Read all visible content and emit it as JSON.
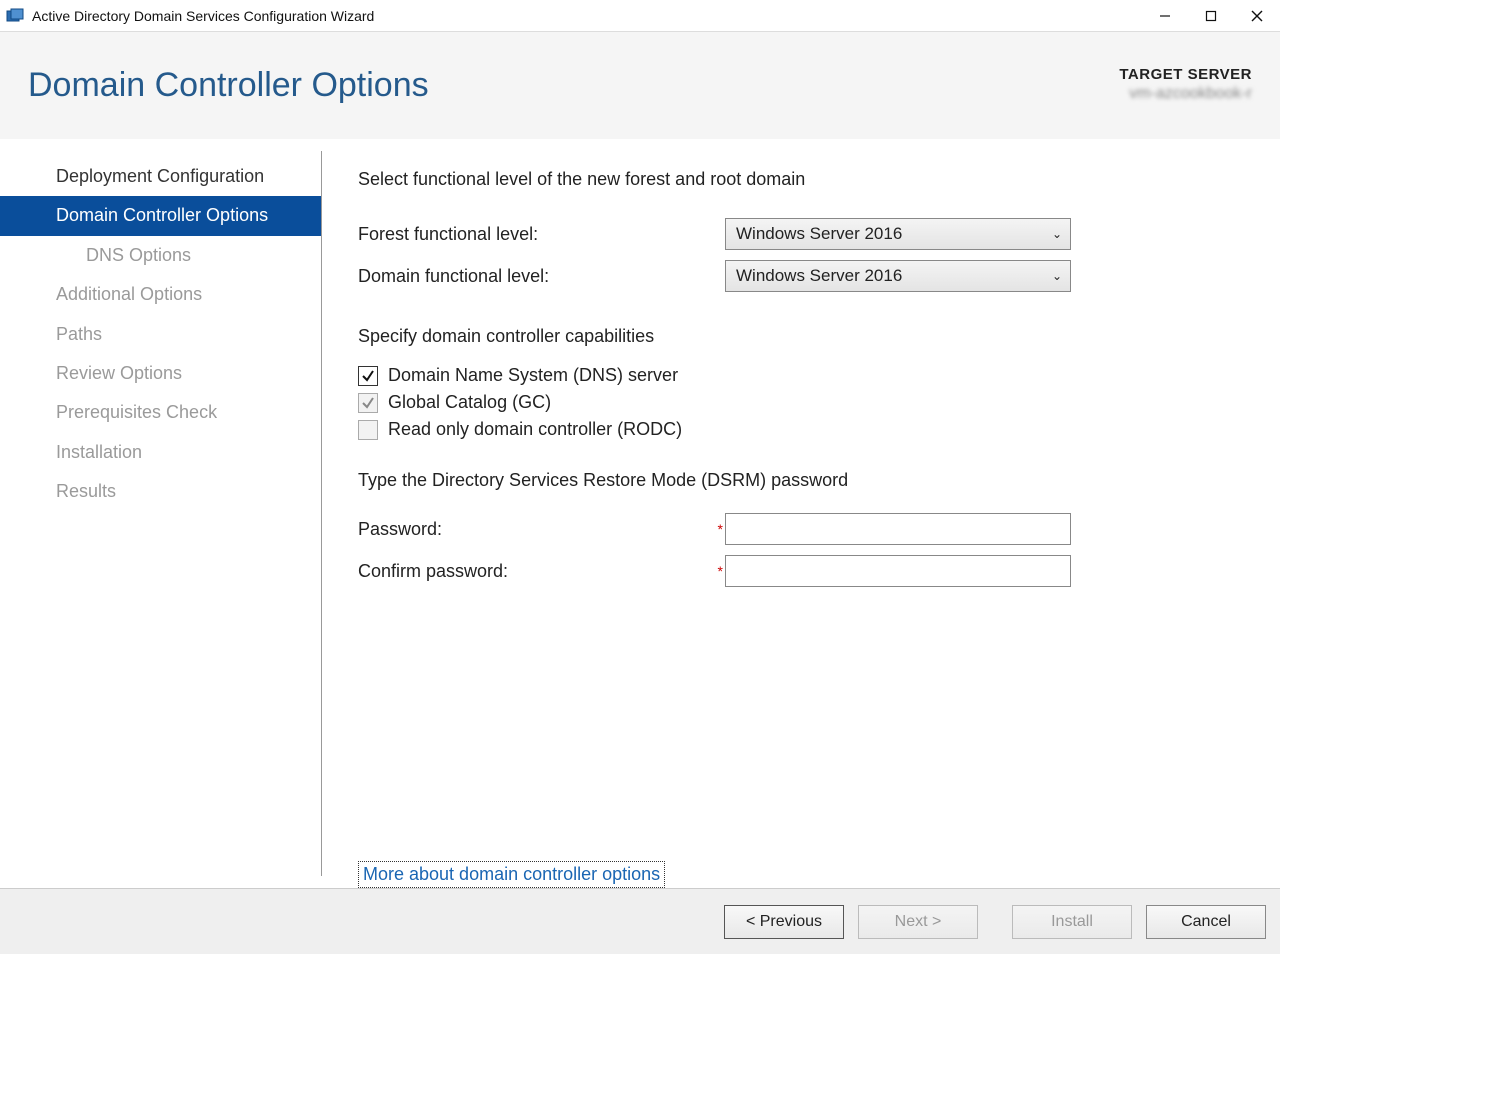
{
  "window": {
    "title": "Active Directory Domain Services Configuration Wizard"
  },
  "header": {
    "page_title": "Domain Controller Options",
    "target_label": "TARGET SERVER",
    "target_value": "vm-azcookbook-r"
  },
  "sidebar": {
    "items": [
      {
        "label": "Deployment Configuration",
        "state": "done"
      },
      {
        "label": "Domain Controller Options",
        "state": "active"
      },
      {
        "label": "DNS Options",
        "state": "sub"
      },
      {
        "label": "Additional Options",
        "state": "pending"
      },
      {
        "label": "Paths",
        "state": "pending"
      },
      {
        "label": "Review Options",
        "state": "pending"
      },
      {
        "label": "Prerequisites Check",
        "state": "pending"
      },
      {
        "label": "Installation",
        "state": "pending"
      },
      {
        "label": "Results",
        "state": "pending"
      }
    ]
  },
  "content": {
    "func_level_heading": "Select functional level of the new forest and root domain",
    "forest_label": "Forest functional level:",
    "forest_value": "Windows Server 2016",
    "domain_label": "Domain functional level:",
    "domain_value": "Windows Server 2016",
    "capabilities_heading": "Specify domain controller capabilities",
    "dns_label": "Domain Name System (DNS) server",
    "gc_label": "Global Catalog (GC)",
    "rodc_label": "Read only domain controller (RODC)",
    "dsrm_heading": "Type the Directory Services Restore Mode (DSRM) password",
    "password_label": "Password:",
    "confirm_label": "Confirm password:",
    "more_link": "More about domain controller options"
  },
  "footer": {
    "previous": "< Previous",
    "next": "Next >",
    "install": "Install",
    "cancel": "Cancel"
  }
}
